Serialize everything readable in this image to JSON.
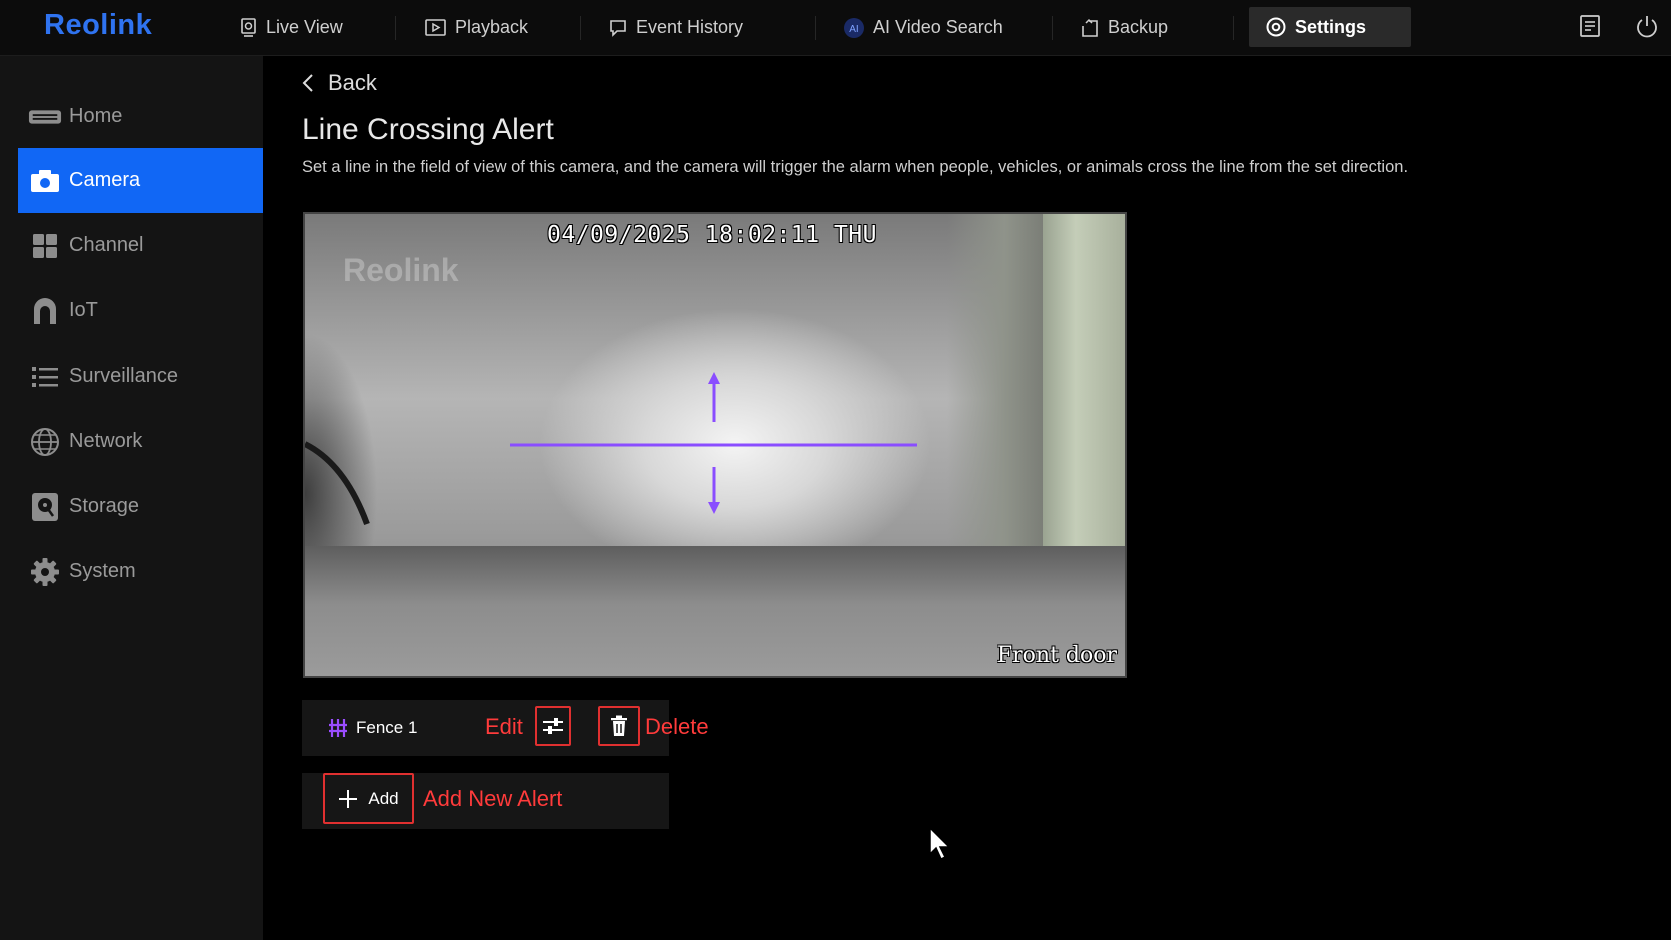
{
  "app": {
    "logo_text": "Reolink"
  },
  "topnav": {
    "items": [
      {
        "label": "Live View",
        "icon": "monitor-icon"
      },
      {
        "label": "Playback",
        "icon": "playback-icon"
      },
      {
        "label": "Event History",
        "icon": "event-history-icon"
      },
      {
        "label": "AI Video Search",
        "icon": "ai-icon"
      },
      {
        "label": "Backup",
        "icon": "backup-icon"
      },
      {
        "label": "Settings",
        "icon": "gear-icon",
        "active": true
      }
    ],
    "right_icons": [
      "notes-icon",
      "power-icon"
    ]
  },
  "sidebar": {
    "items": [
      {
        "label": "Home",
        "icon": "home-icon"
      },
      {
        "label": "Camera",
        "icon": "camera-icon",
        "active": true
      },
      {
        "label": "Channel",
        "icon": "channel-grid-icon"
      },
      {
        "label": "IoT",
        "icon": "iot-icon"
      },
      {
        "label": "Surveillance",
        "icon": "list-icon"
      },
      {
        "label": "Network",
        "icon": "globe-icon"
      },
      {
        "label": "Storage",
        "icon": "storage-icon"
      },
      {
        "label": "System",
        "icon": "gear-icon"
      }
    ]
  },
  "main": {
    "back_label": "Back",
    "title": "Line Crossing Alert",
    "description": "Set a line in the field of view of this camera, and the camera will trigger the alarm when people, vehicles, or animals cross the line from the set direction.",
    "preview": {
      "timestamp": "04/09/2025 18:02:11 THU",
      "watermark": "Reolink",
      "camera_name": "Front door",
      "line_color": "#8a4dff"
    },
    "fence": {
      "name": "Fence 1",
      "edit_annotation": "Edit",
      "delete_annotation": "Delete"
    },
    "add": {
      "button_label": "Add",
      "annotation": "Add New Alert"
    }
  },
  "colors": {
    "accent": "#1167f5",
    "logo": "#2f73f0",
    "annotation_red": "#ff3b3b"
  }
}
